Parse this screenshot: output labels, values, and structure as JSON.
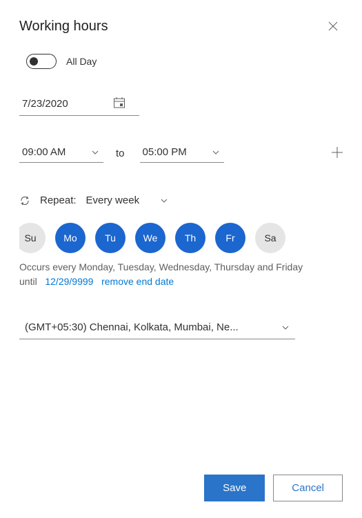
{
  "header": {
    "title": "Working hours"
  },
  "allDay": {
    "label": "All Day",
    "checked": false
  },
  "date": "7/23/2020",
  "time": {
    "start": "09:00 AM",
    "to": "to",
    "end": "05:00 PM"
  },
  "repeat": {
    "label": "Repeat:",
    "value": "Every week"
  },
  "days": [
    {
      "abbr": "Su",
      "active": false
    },
    {
      "abbr": "Mo",
      "active": true
    },
    {
      "abbr": "Tu",
      "active": true
    },
    {
      "abbr": "We",
      "active": true
    },
    {
      "abbr": "Th",
      "active": true
    },
    {
      "abbr": "Fr",
      "active": true
    },
    {
      "abbr": "Sa",
      "active": false
    }
  ],
  "occurs": "Occurs every Monday, Tuesday, Wednesday, Thursday and Friday",
  "until": {
    "label": "until",
    "date": "12/29/9999",
    "remove": "remove end date"
  },
  "timezone": "(GMT+05:30) Chennai, Kolkata, Mumbai, Ne...",
  "footer": {
    "save": "Save",
    "cancel": "Cancel"
  }
}
